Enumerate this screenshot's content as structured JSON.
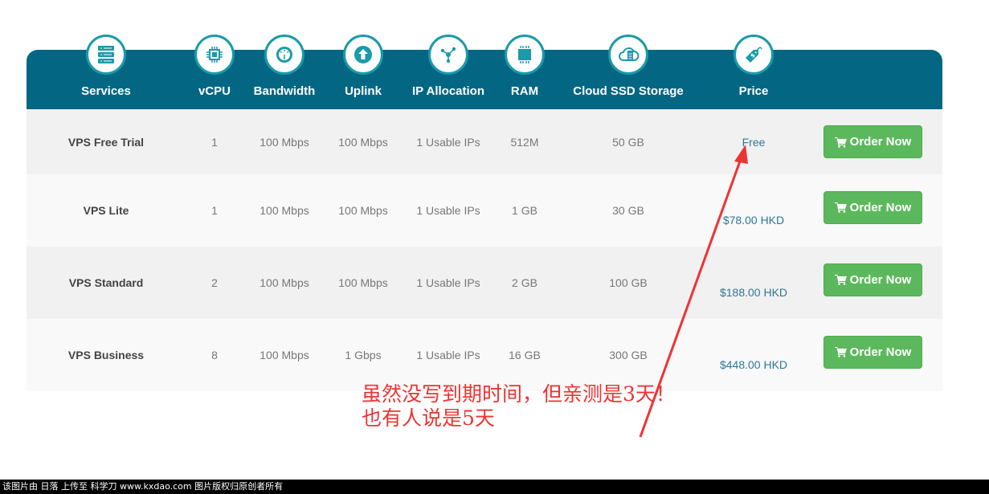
{
  "header": {
    "columns": [
      {
        "label": "Services",
        "icon": "server-icon"
      },
      {
        "label": "vCPU",
        "icon": "cpu-chip-icon"
      },
      {
        "label": "Bandwidth",
        "icon": "speedometer-icon"
      },
      {
        "label": "Uplink",
        "icon": "arrow-up-circle-icon"
      },
      {
        "label": "IP Allocation",
        "icon": "network-nodes-icon"
      },
      {
        "label": "RAM",
        "icon": "memory-chip-icon"
      },
      {
        "label": "Cloud SSD Storage",
        "icon": "cloud-storage-icon"
      },
      {
        "label": "Price",
        "icon": "price-tag-icon"
      }
    ]
  },
  "plans": [
    {
      "name": "VPS Free Trial",
      "vcpu": "1",
      "bandwidth": "100 Mbps",
      "uplink": "100 Mbps",
      "ip": "1 Usable IPs",
      "ram": "512M",
      "storage": "50 GB",
      "price": "Free",
      "button": "Order Now"
    },
    {
      "name": "VPS Lite",
      "vcpu": "1",
      "bandwidth": "100 Mbps",
      "uplink": "100 Mbps",
      "ip": "1 Usable IPs",
      "ram": "1 GB",
      "storage": "30 GB",
      "price": "$78.00 HKD",
      "button": "Order Now"
    },
    {
      "name": "VPS Standard",
      "vcpu": "2",
      "bandwidth": "100 Mbps",
      "uplink": "100 Mbps",
      "ip": "1 Usable IPs",
      "ram": "2 GB",
      "storage": "100 GB",
      "price": "$188.00 HKD",
      "button": "Order Now"
    },
    {
      "name": "VPS Business",
      "vcpu": "8",
      "bandwidth": "100 Mbps",
      "uplink": "1 Gbps",
      "ip": "1 Usable IPs",
      "ram": "16 GB",
      "storage": "300 GB",
      "price": "$448.00 HKD",
      "button": "Order Now"
    }
  ],
  "annotation": {
    "text": "虽然没写到期时间，但亲测是3天！也有人说是5天",
    "color": "#ee3333"
  },
  "watermark": {
    "text": "该图片由 日落 上传至 科学刀 www.kxdao.com 图片版权归原创者所有"
  },
  "colors": {
    "header_bg": "#036784",
    "icon_ring": "#1a9aaa",
    "button_green": "#5cb85c",
    "price_blue": "#2d7895"
  }
}
